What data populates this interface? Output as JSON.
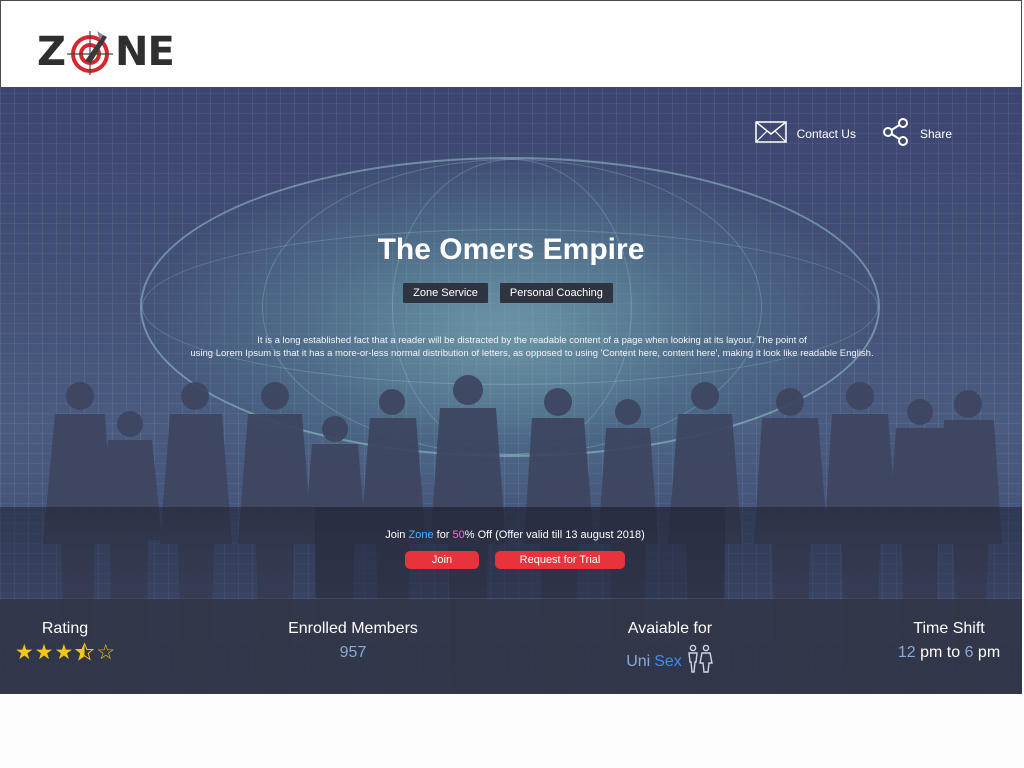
{
  "header": {
    "logo_text_left": "Z",
    "logo_text_right": "NE",
    "logo_icon": "target-icon"
  },
  "hero": {
    "actions": [
      {
        "label": "Contact Us",
        "icon": "envelope-icon"
      },
      {
        "label": "Share",
        "icon": "share-icon"
      }
    ],
    "title": "The Omers Empire",
    "tags": [
      "Zone Service",
      "Personal Coaching"
    ],
    "description_line1": "It is a long established fact that a reader will be distracted by the readable content of a page when looking at its layout. The point of",
    "description_line2": "using Lorem Ipsum is that it has a more-or-less normal distribution of letters, as opposed to using 'Content here, content here', making it look like readable English.",
    "offer": {
      "prefix": "Join ",
      "brand": "Zone",
      "middle": " for ",
      "percent": "50",
      "suffix": "% Off (Offer valid till 13 august 2018)",
      "join_label": "Join",
      "trial_label": "Request for Trial"
    }
  },
  "stats": {
    "rating": {
      "label": "Rating",
      "value": 3.5,
      "max": 5
    },
    "members": {
      "label": "Enrolled Members",
      "value": "957"
    },
    "available": {
      "label": "Avaiable for",
      "value_uni": "Uni",
      "value_sex": "Sex",
      "icon": "unisex-people-icon"
    },
    "time": {
      "label": "Time Shift",
      "start": "12",
      "mid": " pm to ",
      "end": "6",
      "end_suffix": " pm"
    }
  },
  "colors": {
    "accent_red": "#e8323c",
    "highlight_blue": "#47b0ff",
    "highlight_pink": "#ff66cc",
    "star": "#f5c518",
    "stat_value": "#8aa9d8"
  }
}
